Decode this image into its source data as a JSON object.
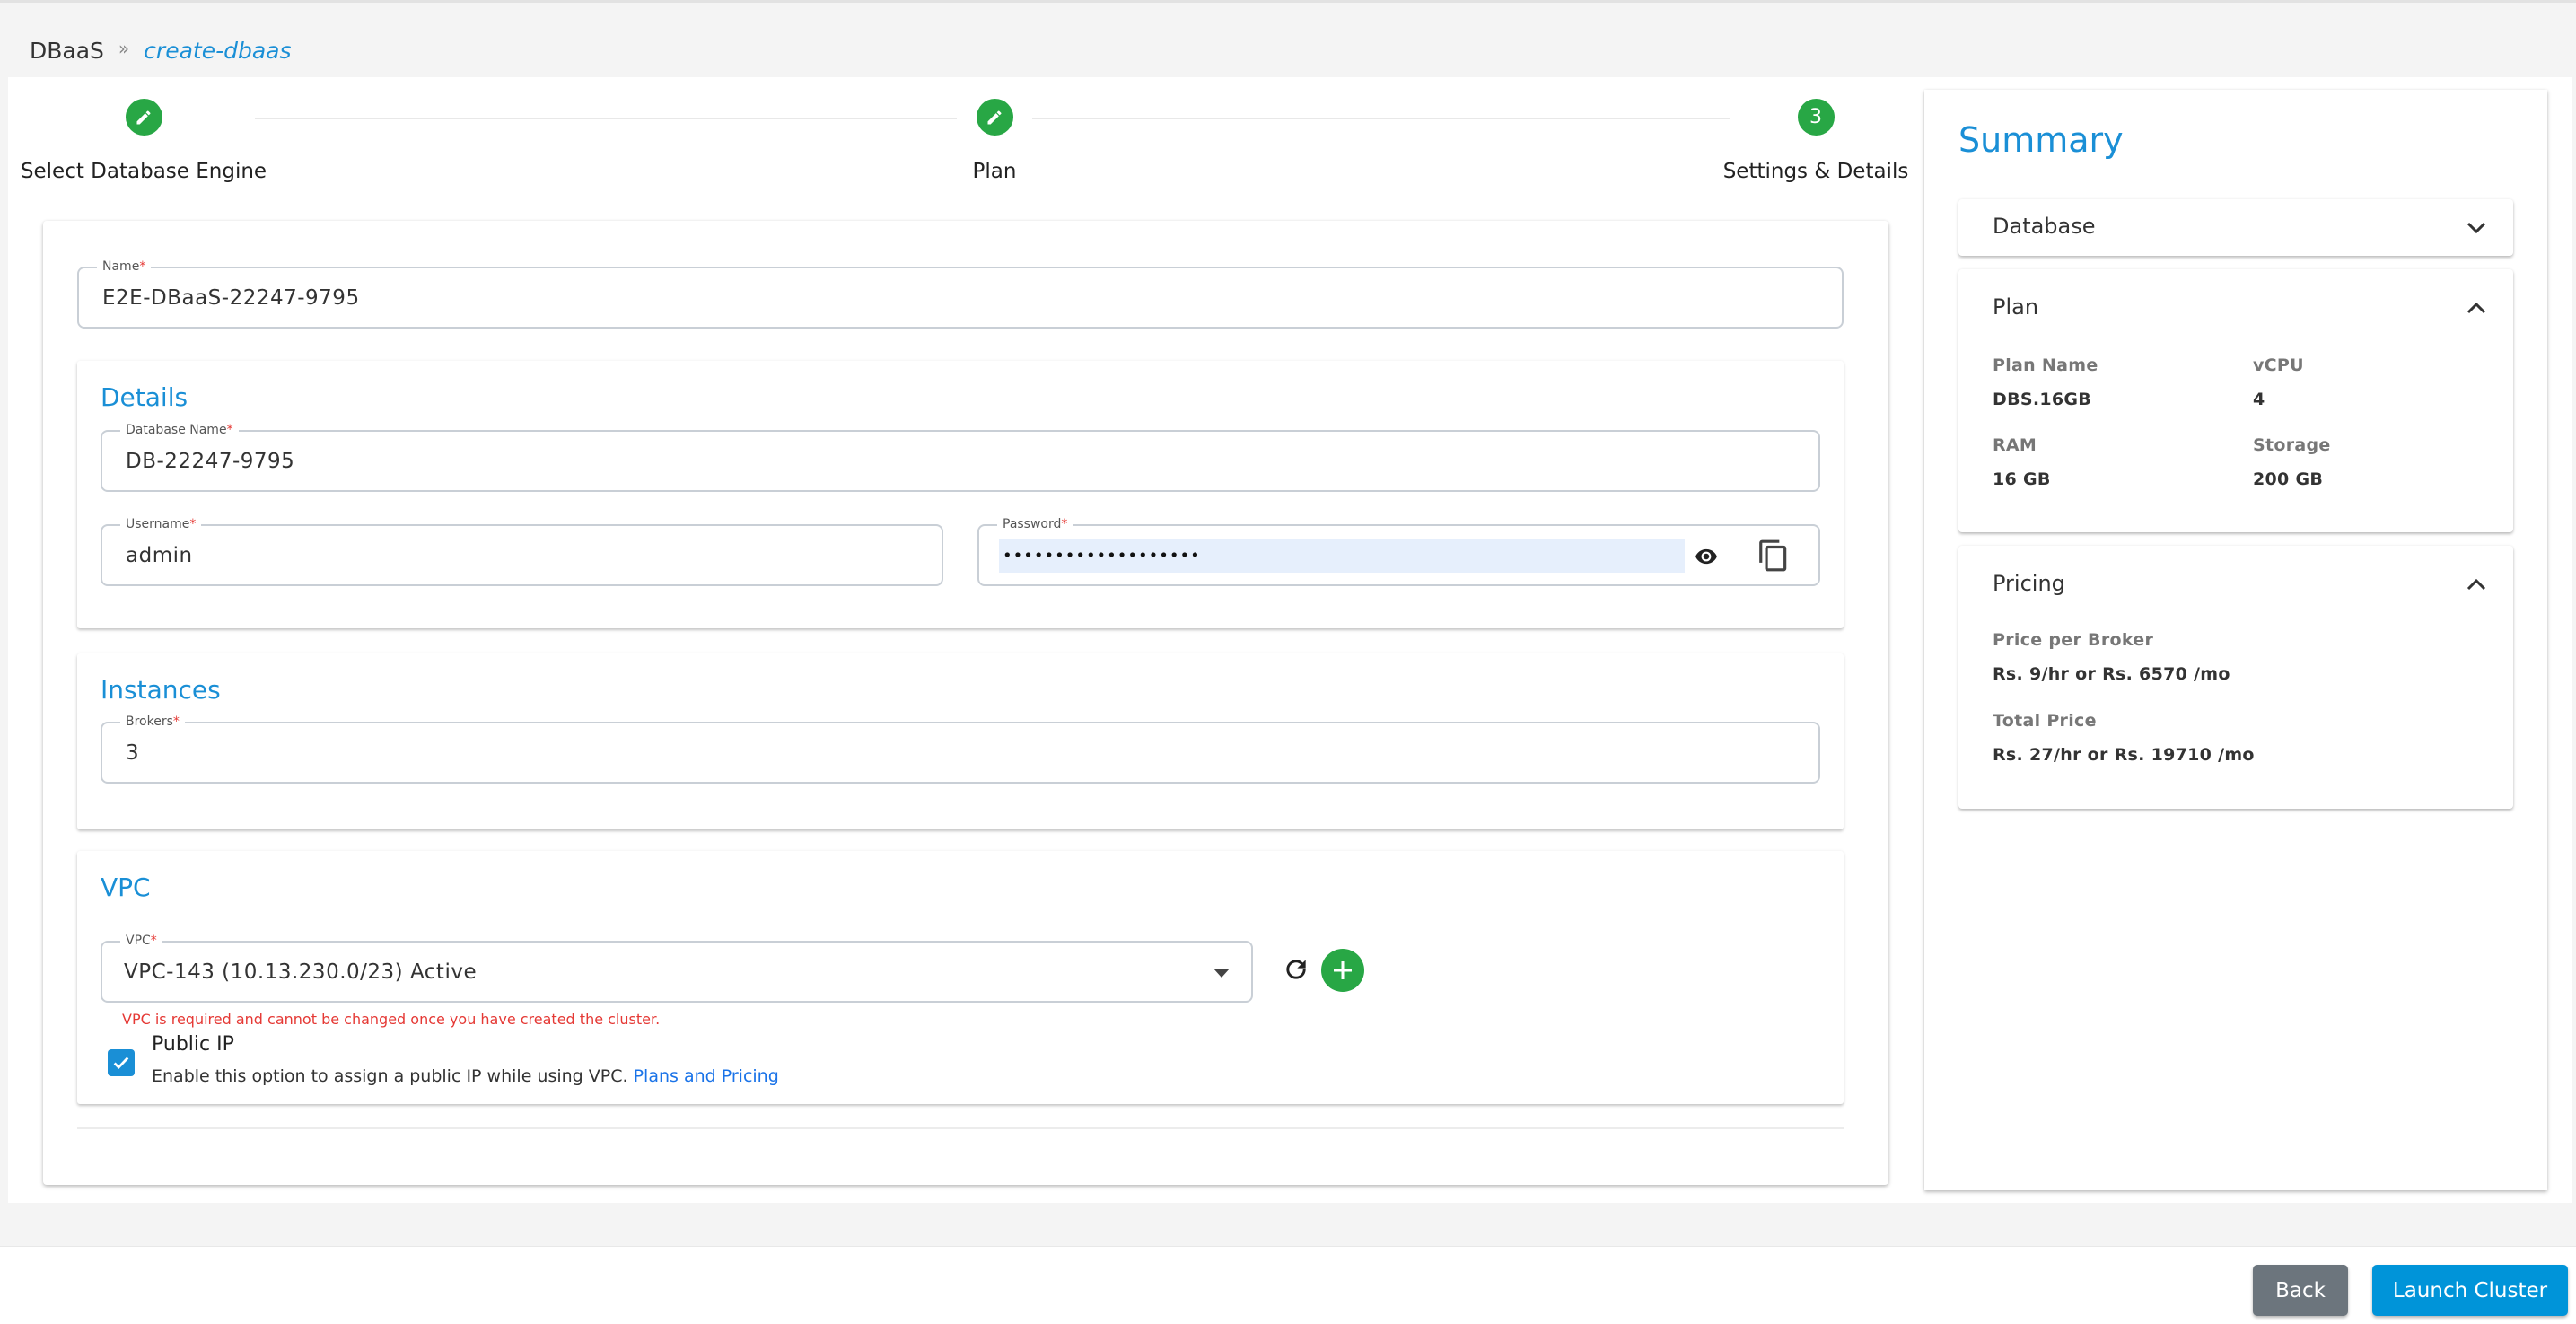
{
  "breadcrumb": {
    "root": "DBaaS",
    "separator": "»",
    "current": "create-dbaas"
  },
  "stepper": {
    "steps": [
      {
        "label": "Select Database Engine",
        "state": "completed",
        "icon": "pencil-icon"
      },
      {
        "label": "Plan",
        "state": "completed",
        "icon": "pencil-icon"
      },
      {
        "label": "Settings & Details",
        "state": "active",
        "number": "3"
      }
    ]
  },
  "form": {
    "name": {
      "label": "Name",
      "required_mark": "*",
      "value": "E2E-DBaaS-22247-9795"
    },
    "details": {
      "title": "Details",
      "database_name": {
        "label": "Database Name",
        "required_mark": "*",
        "value": "DB-22247-9795"
      },
      "username": {
        "label": "Username",
        "required_mark": "*",
        "value": "admin"
      },
      "password": {
        "label": "Password",
        "required_mark": "*",
        "masked_value": "•••••••••••••••••••",
        "show_icon": "eye-icon",
        "copy_icon": "copy-icon"
      }
    },
    "instances": {
      "title": "Instances",
      "brokers": {
        "label": "Brokers",
        "required_mark": "*",
        "value": "3"
      }
    },
    "vpc": {
      "title": "VPC",
      "select": {
        "label": "VPC",
        "required_mark": "*",
        "value": "VPC-143 (10.13.230.0/23) Active"
      },
      "helper_error": "VPC is required and cannot be changed once you have created the cluster.",
      "refresh_icon": "refresh-icon",
      "add_icon": "add-circle-icon",
      "public_ip": {
        "checked": true,
        "title": "Public IP",
        "description": "Enable this option to assign a public IP while using VPC.",
        "link": "Plans and Pricing"
      }
    }
  },
  "summary": {
    "title": "Summary",
    "database": {
      "title": "Database",
      "expanded": false
    },
    "plan": {
      "title": "Plan",
      "expanded": true,
      "items": [
        {
          "label": "Plan Name",
          "value": "DBS.16GB"
        },
        {
          "label": "vCPU",
          "value": "4"
        },
        {
          "label": "RAM",
          "value": "16 GB"
        },
        {
          "label": "Storage",
          "value": "200 GB"
        }
      ]
    },
    "pricing": {
      "title": "Pricing",
      "expanded": true,
      "items": [
        {
          "label": "Price per Broker",
          "value": "Rs. 9/hr or Rs. 6570 /mo"
        },
        {
          "label": "Total Price",
          "value": "Rs. 27/hr or Rs. 19710 /mo"
        }
      ]
    }
  },
  "footer": {
    "back_label": "Back",
    "launch_label": "Launch Cluster"
  },
  "colors": {
    "accent": "#1a8fd6",
    "success": "#28a745",
    "error": "#e53935",
    "back_button": "#6c757d",
    "launch_button": "#0094d9"
  }
}
